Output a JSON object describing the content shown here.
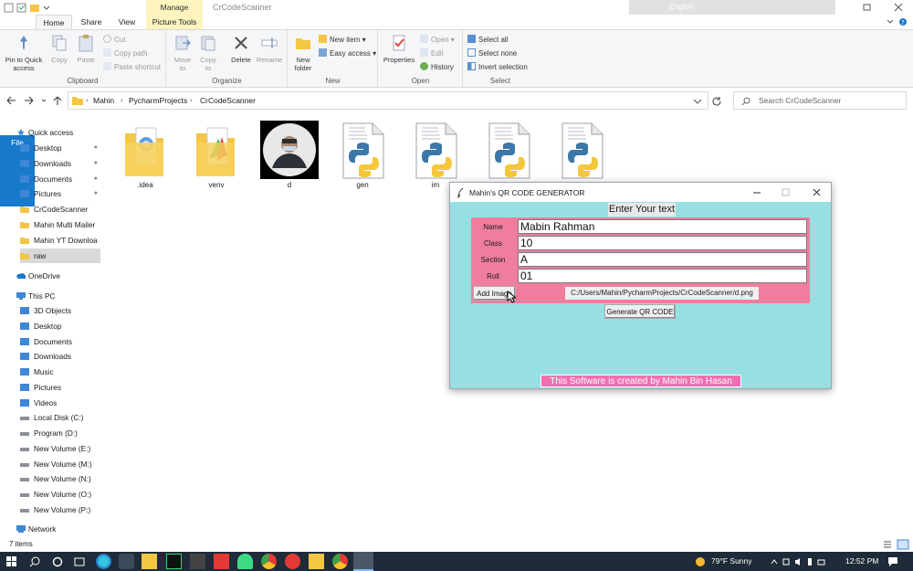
{
  "window": {
    "title": "CrCodeScanner",
    "contextual_tab": "Manage",
    "tabs": [
      "File",
      "Home",
      "Share",
      "View",
      "Picture Tools"
    ],
    "lang": "English"
  },
  "ribbon": {
    "clipboard": {
      "label": "Clipboard",
      "pin_line1": "Pin to Quick",
      "pin_line2": "access",
      "copy": "Copy",
      "paste": "Paste",
      "cut": "Cut",
      "copy_path": "Copy path",
      "paste_shortcut": "Paste shortcut"
    },
    "organize": {
      "label": "Organize",
      "move_line1": "Move",
      "move_line2": "to",
      "copy_line1": "Copy",
      "copy_line2": "to",
      "delete": "Delete",
      "rename": "Rename"
    },
    "new": {
      "label": "New",
      "folder_line1": "New",
      "folder_line2": "folder",
      "new_item": "New item",
      "easy_access": "Easy access"
    },
    "open": {
      "label": "Open",
      "properties": "Properties",
      "open": "Open",
      "edit": "Edit",
      "history": "History"
    },
    "select": {
      "label": "Select",
      "select_all": "Select all",
      "select_none": "Select none",
      "invert": "Invert selection"
    }
  },
  "address": {
    "crumbs": [
      "Mahin",
      "PycharmProjects",
      "CrCodeScanner"
    ],
    "search_placeholder": "Search CrCodeScanner"
  },
  "nav": {
    "quick_access": "Quick access",
    "quick_items": [
      "Desktop",
      "Downloads",
      "Documents",
      "Pictures",
      "CrCodeScanner",
      "Mahin Multi Mailer",
      "Mahin YT Downloa",
      "raw"
    ],
    "onedrive": "OneDrive",
    "this_pc": "This PC",
    "pc_items": [
      "3D Objects",
      "Desktop",
      "Documents",
      "Downloads",
      "Music",
      "Pictures",
      "Videos",
      "Local Disk (C:)",
      "Program (D:)",
      "New Volume (E:)",
      "New Volume (M:)",
      "New Volume (N:)",
      "New Volume (O:)",
      "New Volume (P:)"
    ],
    "network": "Network"
  },
  "files": [
    ".idea",
    "venv",
    "d",
    "gen",
    "im",
    "",
    ""
  ],
  "status": {
    "count": "7 items"
  },
  "taskbar": {
    "weather": "79°F Sunny",
    "time": "12:52 PM"
  },
  "qr_app": {
    "title": "Mahin's QR CODE GENERATOR",
    "heading": "Enter Your text",
    "fields": [
      {
        "label": "Name",
        "value": "Mabin Rahman"
      },
      {
        "label": "Class",
        "value": "10"
      },
      {
        "label": "Section",
        "value": "A"
      },
      {
        "label": "Roll",
        "value": "01"
      }
    ],
    "add_image": "Add Image",
    "image_path": "C:/Users/Mahin/PycharmProjects/CrCodeScanner/d.png",
    "generate": "Generate QR CODE",
    "footer": "This Software is created by Mahin Bin Hasan"
  },
  "colors": {
    "accent": "#1979ca",
    "tk_bg": "#98dfe3",
    "tk_pink": "#ef7e9e",
    "footer_pink": "#f06fb0"
  }
}
